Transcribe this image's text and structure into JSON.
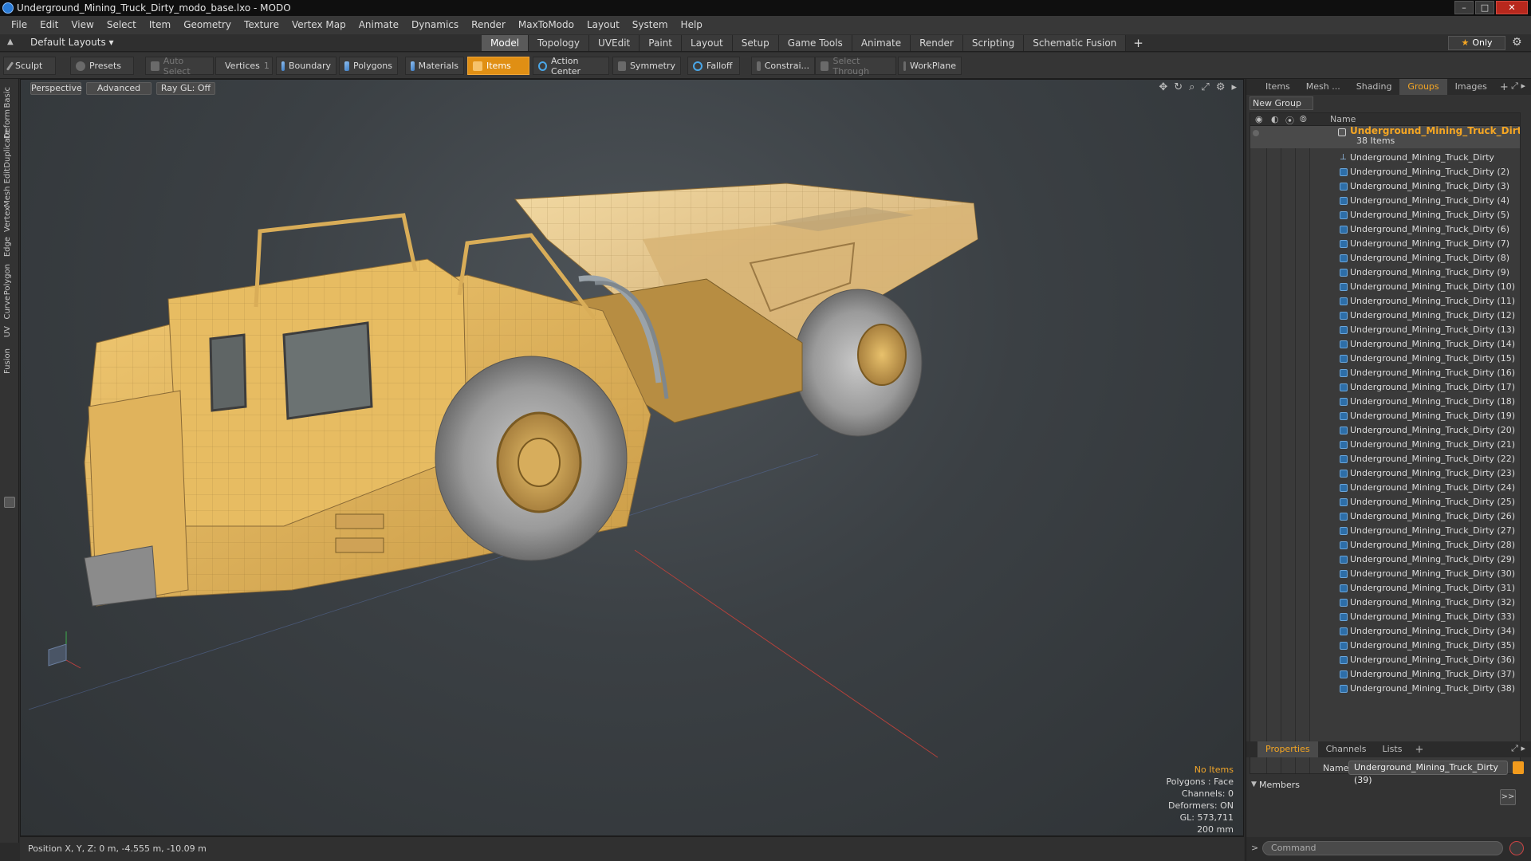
{
  "window": {
    "title": "Underground_Mining_Truck_Dirty_modo_base.lxo - MODO",
    "minimize": "–",
    "maximize": "□",
    "close": "✕"
  },
  "menu": [
    "File",
    "Edit",
    "View",
    "Select",
    "Item",
    "Geometry",
    "Texture",
    "Vertex Map",
    "Animate",
    "Dynamics",
    "Render",
    "MaxToModo",
    "Layout",
    "System",
    "Help"
  ],
  "layout": {
    "preset": "Default Layouts ▾",
    "tabs": [
      "Model",
      "Topology",
      "UVEdit",
      "Paint",
      "Layout",
      "Setup",
      "Game Tools",
      "Animate",
      "Render",
      "Scripting",
      "Schematic Fusion"
    ],
    "active_tab": "Model",
    "add": "+",
    "only": "Only"
  },
  "toolbar": {
    "sculpt": "Sculpt",
    "presets": "Presets",
    "auto_select": "Auto Select",
    "vertices": "Vertices",
    "vertices_count": "1",
    "boundary": "Boundary",
    "polygons": "Polygons",
    "materials": "Materials",
    "items": "Items",
    "action_center": "Action Center",
    "symmetry": "Symmetry",
    "falloff": "Falloff",
    "constraints": "Constrai...",
    "select_through": "Select Through",
    "workplane": "WorkPlane"
  },
  "left_tabs": [
    "Basic",
    "Deform",
    "Duplicate",
    "Mesh Edit",
    "Vertex",
    "Edge",
    "Polygon",
    "Curve",
    "UV",
    "Fusion"
  ],
  "viewport": {
    "view_mode": "Perspective",
    "shading": "Advanced",
    "raygl": "Ray GL: Off",
    "stats": {
      "selection": "No Items",
      "polygons": "Polygons : Face",
      "channels": "Channels: 0",
      "deformers": "Deformers: ON",
      "gl": "GL: 573,711",
      "scale": "200 mm"
    }
  },
  "status": {
    "position": "Position X, Y, Z:  0 m, -4.555 m, -10.09 m"
  },
  "panel_top": {
    "tabs": [
      "Items",
      "Mesh ...",
      "Shading",
      "Groups",
      "Images"
    ],
    "active_tab": "Groups",
    "new_group": "New Group",
    "column_name": "Name",
    "group_name": "Underground_Mining_Truck_Dirty",
    "group_count": "38 Items",
    "items": [
      "Underground_Mining_Truck_Dirty",
      "Underground_Mining_Truck_Dirty (2)",
      "Underground_Mining_Truck_Dirty (3)",
      "Underground_Mining_Truck_Dirty (4)",
      "Underground_Mining_Truck_Dirty (5)",
      "Underground_Mining_Truck_Dirty (6)",
      "Underground_Mining_Truck_Dirty (7)",
      "Underground_Mining_Truck_Dirty (8)",
      "Underground_Mining_Truck_Dirty (9)",
      "Underground_Mining_Truck_Dirty (10)",
      "Underground_Mining_Truck_Dirty (11)",
      "Underground_Mining_Truck_Dirty (12)",
      "Underground_Mining_Truck_Dirty (13)",
      "Underground_Mining_Truck_Dirty (14)",
      "Underground_Mining_Truck_Dirty (15)",
      "Underground_Mining_Truck_Dirty (16)",
      "Underground_Mining_Truck_Dirty (17)",
      "Underground_Mining_Truck_Dirty (18)",
      "Underground_Mining_Truck_Dirty (19)",
      "Underground_Mining_Truck_Dirty (20)",
      "Underground_Mining_Truck_Dirty (21)",
      "Underground_Mining_Truck_Dirty (22)",
      "Underground_Mining_Truck_Dirty (23)",
      "Underground_Mining_Truck_Dirty (24)",
      "Underground_Mining_Truck_Dirty (25)",
      "Underground_Mining_Truck_Dirty (26)",
      "Underground_Mining_Truck_Dirty (27)",
      "Underground_Mining_Truck_Dirty (28)",
      "Underground_Mining_Truck_Dirty (29)",
      "Underground_Mining_Truck_Dirty (30)",
      "Underground_Mining_Truck_Dirty (31)",
      "Underground_Mining_Truck_Dirty (32)",
      "Underground_Mining_Truck_Dirty (33)",
      "Underground_Mining_Truck_Dirty (34)",
      "Underground_Mining_Truck_Dirty (35)",
      "Underground_Mining_Truck_Dirty (36)",
      "Underground_Mining_Truck_Dirty (37)",
      "Underground_Mining_Truck_Dirty (38)"
    ]
  },
  "panel_bottom": {
    "tabs": [
      "Properties",
      "Channels",
      "Lists"
    ],
    "active_tab": "Properties",
    "name_label": "Name",
    "name_value": "Underground_Mining_Truck_Dirty (39)",
    "members": "Members",
    "forward": ">>",
    "command_placeholder": "Command"
  },
  "colors": {
    "accent": "#f5a623",
    "truck_body": "#e8b95a",
    "selection_orange": "#e08f14"
  }
}
